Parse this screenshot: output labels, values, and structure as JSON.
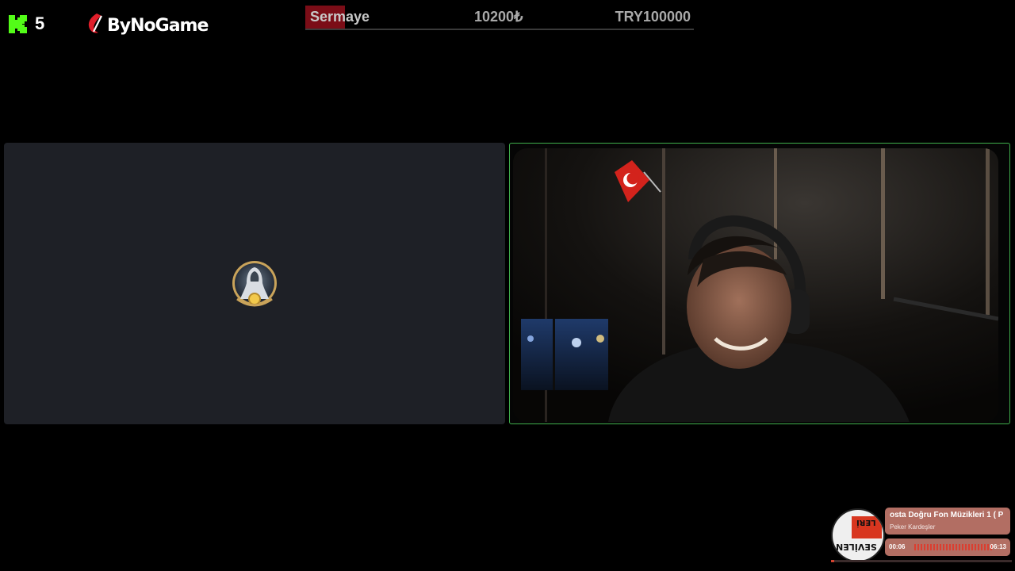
{
  "kick": {
    "viewer_count": "5"
  },
  "bynogame": {
    "brand": "ByNoGame"
  },
  "capital": {
    "label": "Sermaye",
    "current": "10200₺",
    "target": "TRY100000",
    "progress": 0.102,
    "fill_color": "#7b0d17"
  },
  "left_panel": {
    "avatar_icon": "hooded-figure-avatar-icon"
  },
  "webcam": {
    "description_icons": [
      "turkish-flag-icon",
      "headphones-icon"
    ]
  },
  "music": {
    "title": "osta Doğru Fon Müzikleri 1 ( P",
    "artist": "Peker Kardeşler",
    "time_current": "00:06",
    "time_total": "06:13",
    "progress": 0.016,
    "disc_text": "SEVİLEN",
    "disc_text2": "LERİ",
    "card_color": "#b26e63"
  },
  "colors": {
    "kick_green": "#53fc18",
    "webcam_border": "#3fae4c",
    "panel_bg": "#1e2026"
  }
}
